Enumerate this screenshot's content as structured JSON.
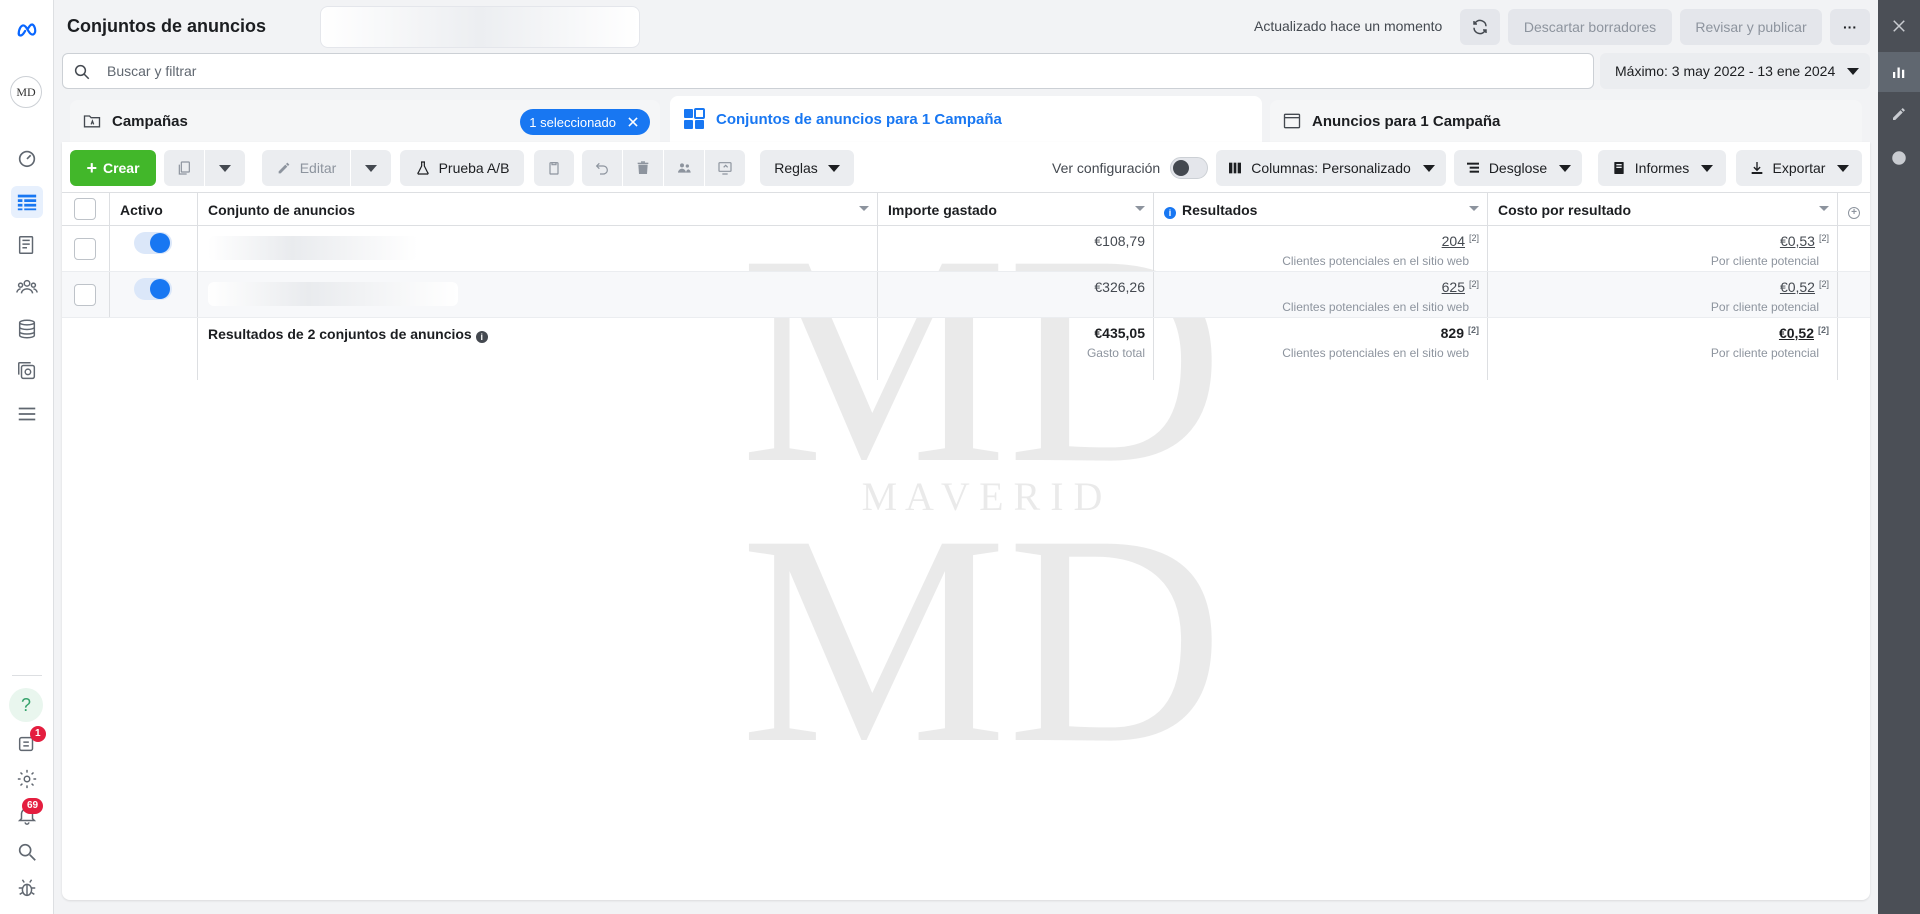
{
  "header": {
    "title": "Conjuntos de anuncios",
    "updated": "Actualizado hace un momento",
    "discard_label": "Descartar borradores",
    "review_label": "Revisar y publicar",
    "more_label": "···"
  },
  "search": {
    "placeholder": "Buscar y filtrar"
  },
  "date_range": "Máximo: 3 may 2022 - 13 ene 2024",
  "tabs": {
    "campaigns": "Campañas",
    "selected_chip": "1 seleccionado",
    "adsets": "Conjuntos de anuncios para 1 Campaña",
    "ads": "Anuncios para 1 Campaña"
  },
  "toolbar": {
    "create": "Crear",
    "edit": "Editar",
    "ab_test": "Prueba A/B",
    "rules": "Reglas",
    "view_config": "Ver configuración",
    "columns": "Columnas: Personalizado",
    "breakdown": "Desglose",
    "reports": "Informes",
    "export": "Exportar"
  },
  "table": {
    "headers": {
      "active": "Activo",
      "adset": "Conjunto de anuncios",
      "spent": "Importe gastado",
      "results": "Resultados",
      "cost": "Costo por resultado"
    },
    "rows": [
      {
        "spent": "€108,79",
        "results": "204",
        "results_sub": "Clientes potenciales en el sitio web",
        "cost": "€0,53",
        "cost_sub": "Por cliente potencial",
        "note": "[2]"
      },
      {
        "spent": "€326,26",
        "results": "625",
        "results_sub": "Clientes potenciales en el sitio web",
        "cost": "€0,52",
        "cost_sub": "Por cliente potencial",
        "note": "[2]"
      }
    ],
    "summary": {
      "label": "Resultados de 2 conjuntos de anuncios",
      "info": "i",
      "spent": "€435,05",
      "spent_sub": "Gasto total",
      "results": "829",
      "results_sub": "Clientes potenciales en el sitio web",
      "cost": "€0,52",
      "cost_sub": "Por cliente potencial",
      "note": "[2]"
    }
  },
  "watermark": {
    "logo": "MD",
    "text": "M A V E R I D"
  },
  "rail": {
    "avatar": "MD",
    "help": "?",
    "notif_badge": "1",
    "alerts_badge": "69"
  }
}
